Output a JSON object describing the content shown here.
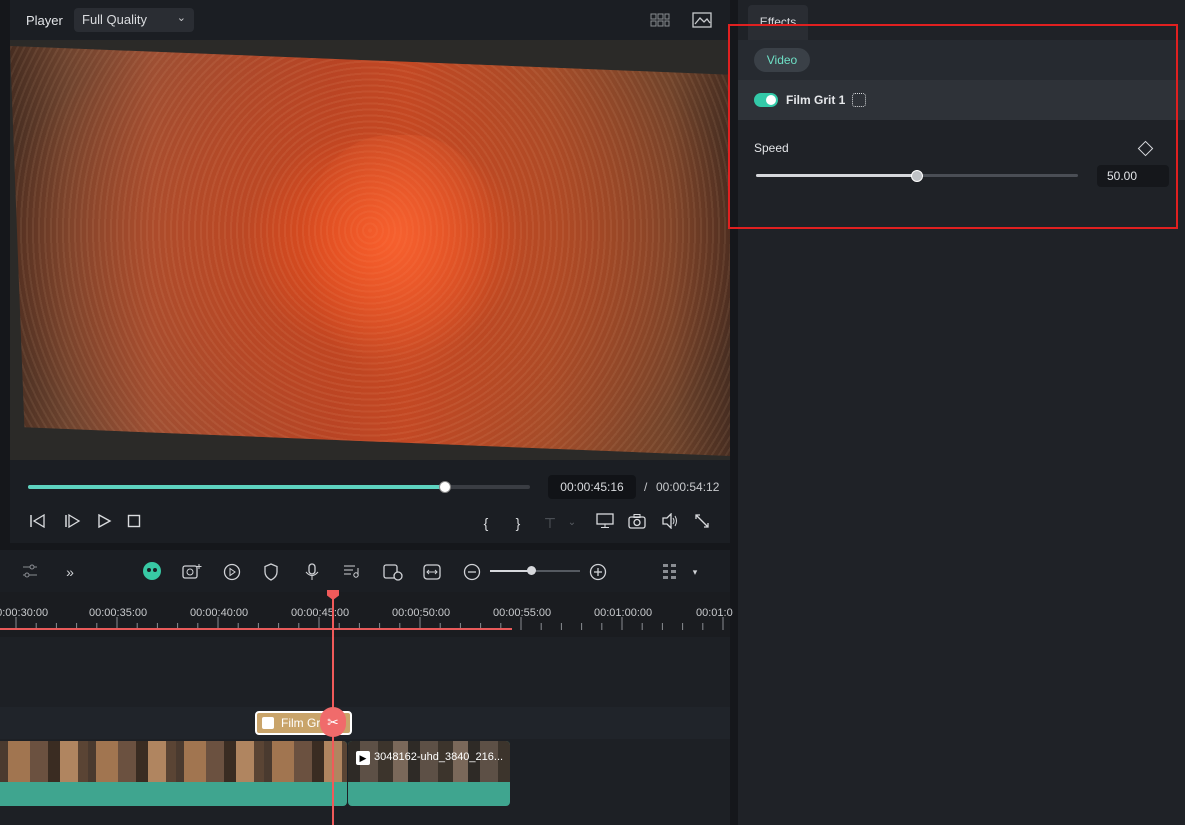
{
  "player": {
    "label": "Player",
    "quality": "Full Quality",
    "progress_fraction": 0.83,
    "current_time": "00:00:45:16",
    "separator": "/",
    "total_time": "00:00:54:12"
  },
  "effects_panel": {
    "tab": "Effects",
    "category": "Video",
    "effect_name": "Film Grit 1",
    "effect_enabled": true,
    "param_label": "Speed",
    "param_value": "50.00",
    "param_fraction": 0.5
  },
  "timeline": {
    "ruler": [
      "00:00:30:00",
      "00:00:35:00",
      "00:00:40:00",
      "00:00:45:00",
      "00:00:50:00",
      "00:00:55:00",
      "00:01:00:00",
      "00:01:0"
    ],
    "fx_clip_label": "Film Grit",
    "video_clip_b_label": "3048162-uhd_3840_216..."
  },
  "colors": {
    "accent": "#5ed3c0",
    "toggle": "#33c9a8",
    "clip": "#3fa58f",
    "playhead": "#f05a5a",
    "highlight": "#e02020"
  }
}
